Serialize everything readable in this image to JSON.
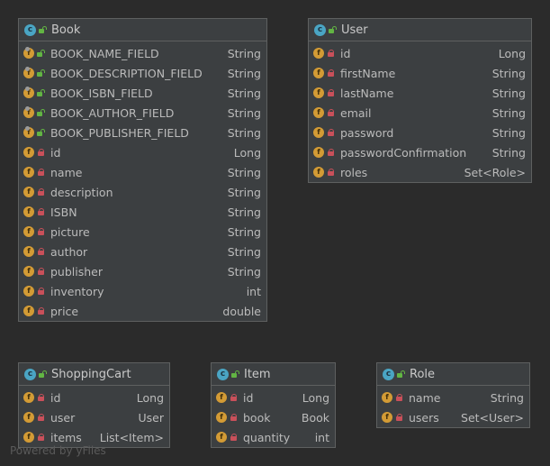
{
  "classes": {
    "book": {
      "icon": "class-icon",
      "icon_letter": "c",
      "name": "Book",
      "fields": [
        {
          "icon_letter": "f",
          "name": "BOOK_NAME_FIELD",
          "type": "String",
          "static": true,
          "visibility": "public"
        },
        {
          "icon_letter": "f",
          "name": "BOOK_DESCRIPTION_FIELD",
          "type": "String",
          "static": true,
          "visibility": "public"
        },
        {
          "icon_letter": "f",
          "name": "BOOK_ISBN_FIELD",
          "type": "String",
          "static": true,
          "visibility": "public"
        },
        {
          "icon_letter": "f",
          "name": "BOOK_AUTHOR_FIELD",
          "type": "String",
          "static": true,
          "visibility": "public"
        },
        {
          "icon_letter": "f",
          "name": "BOOK_PUBLISHER_FIELD",
          "type": "String",
          "static": true,
          "visibility": "public"
        },
        {
          "icon_letter": "f",
          "name": "id",
          "type": "Long",
          "static": false,
          "visibility": "private"
        },
        {
          "icon_letter": "f",
          "name": "name",
          "type": "String",
          "static": false,
          "visibility": "private"
        },
        {
          "icon_letter": "f",
          "name": "description",
          "type": "String",
          "static": false,
          "visibility": "private"
        },
        {
          "icon_letter": "f",
          "name": "ISBN",
          "type": "String",
          "static": false,
          "visibility": "private"
        },
        {
          "icon_letter": "f",
          "name": "picture",
          "type": "String",
          "static": false,
          "visibility": "private"
        },
        {
          "icon_letter": "f",
          "name": "author",
          "type": "String",
          "static": false,
          "visibility": "private"
        },
        {
          "icon_letter": "f",
          "name": "publisher",
          "type": "String",
          "static": false,
          "visibility": "private"
        },
        {
          "icon_letter": "f",
          "name": "inventory",
          "type": "int",
          "static": false,
          "visibility": "private"
        },
        {
          "icon_letter": "f",
          "name": "price",
          "type": "double",
          "static": false,
          "visibility": "private"
        }
      ]
    },
    "user": {
      "icon": "class-icon",
      "icon_letter": "c",
      "name": "User",
      "fields": [
        {
          "icon_letter": "f",
          "name": "id",
          "type": "Long",
          "static": false,
          "visibility": "private"
        },
        {
          "icon_letter": "f",
          "name": "firstName",
          "type": "String",
          "static": false,
          "visibility": "private"
        },
        {
          "icon_letter": "f",
          "name": "lastName",
          "type": "String",
          "static": false,
          "visibility": "private"
        },
        {
          "icon_letter": "f",
          "name": "email",
          "type": "String",
          "static": false,
          "visibility": "private"
        },
        {
          "icon_letter": "f",
          "name": "password",
          "type": "String",
          "static": false,
          "visibility": "private"
        },
        {
          "icon_letter": "f",
          "name": "passwordConfirmation",
          "type": "String",
          "static": false,
          "visibility": "private"
        },
        {
          "icon_letter": "f",
          "name": "roles",
          "type": "Set<Role>",
          "static": false,
          "visibility": "private"
        }
      ]
    },
    "shopping_cart": {
      "icon": "class-icon",
      "icon_letter": "c",
      "name": "ShoppingCart",
      "fields": [
        {
          "icon_letter": "f",
          "name": "id",
          "type": "Long",
          "static": false,
          "visibility": "private"
        },
        {
          "icon_letter": "f",
          "name": "user",
          "type": "User",
          "static": false,
          "visibility": "private"
        },
        {
          "icon_letter": "f",
          "name": "items",
          "type": "List<Item>",
          "static": false,
          "visibility": "private"
        }
      ]
    },
    "item": {
      "icon": "class-icon",
      "icon_letter": "c",
      "name": "Item",
      "fields": [
        {
          "icon_letter": "f",
          "name": "id",
          "type": "Long",
          "static": false,
          "visibility": "private"
        },
        {
          "icon_letter": "f",
          "name": "book",
          "type": "Book",
          "static": false,
          "visibility": "private"
        },
        {
          "icon_letter": "f",
          "name": "quantity",
          "type": "int",
          "static": false,
          "visibility": "private"
        }
      ]
    },
    "role": {
      "icon": "class-icon",
      "icon_letter": "c",
      "name": "Role",
      "fields": [
        {
          "icon_letter": "f",
          "name": "name",
          "type": "String",
          "static": false,
          "visibility": "private"
        },
        {
          "icon_letter": "f",
          "name": "users",
          "type": "Set<User>",
          "static": false,
          "visibility": "private"
        }
      ]
    }
  },
  "watermark": "Powered by yFiles",
  "colors": {
    "background": "#2b2b2b",
    "box": "#3c3f41",
    "border": "#5e6060",
    "class_icon": "#4aa5c4",
    "field_icon": "#d39b35",
    "private_lock": "#c9505a",
    "public_lock": "#62b543",
    "text": "#bbbbbb"
  }
}
